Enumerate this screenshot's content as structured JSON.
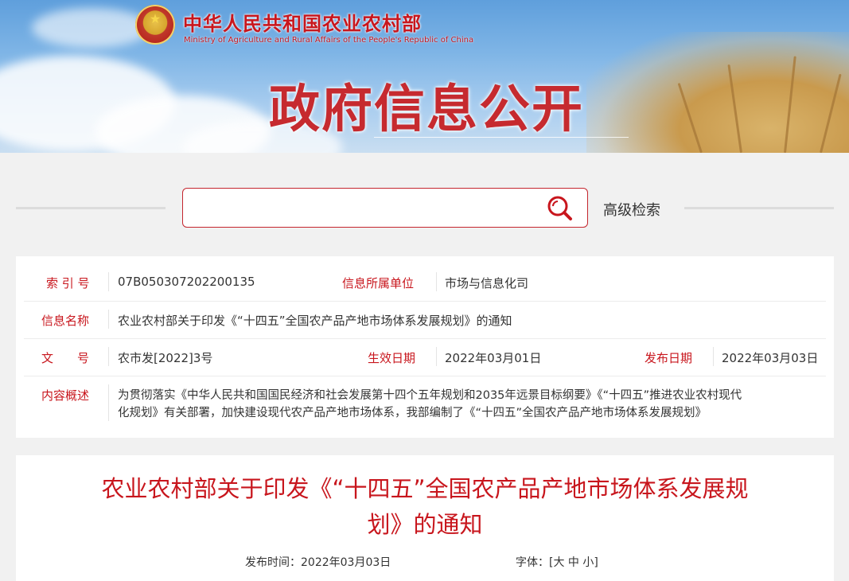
{
  "header": {
    "ministry_cn": "中华人民共和国农业农村部",
    "ministry_en": "Ministry of Agriculture and Rural Affairs of the People's Republic of China",
    "banner_title": "政府信息公开"
  },
  "search": {
    "placeholder": "",
    "advanced_label": "高级检索"
  },
  "info": {
    "index_label": "索 引 号",
    "index_value": "07B050307202200135",
    "unit_label": "信息所属单位",
    "unit_value": "市场与信息化司",
    "name_label": "信息名称",
    "name_value": "农业农村部关于印发《“十四五”全国农产品产地市场体系发展规划》的通知",
    "doc_label": "文　　号",
    "doc_value": "农市发[2022]3号",
    "effective_label": "生效日期",
    "effective_value": "2022年03月01日",
    "publish_label": "发布日期",
    "publish_value": "2022年03月03日",
    "summary_label": "内容概述",
    "summary_line1": "为贯彻落实《中华人民共和国国民经济和社会发展第十四个五年规划和2035年远景目标纲要》《“十四五”推进农业农村现代",
    "summary_line2": "化规划》有关部署，加快建设现代农产品产地市场体系，我部编制了《“十四五”全国农产品产地市场体系发展规划》"
  },
  "article": {
    "title_line1": "农业农村部关于印发《“十四五”全国农产品产地市场体系发展规",
    "title_line2": "划》的通知",
    "publish_time_label": "发布时间：",
    "publish_time_value": "2022年03月03日",
    "font_size_label": "字体：",
    "font_bracket_open": "[",
    "font_large": "大",
    "font_medium": "中",
    "font_small": "小",
    "font_bracket_close": "]"
  },
  "colors": {
    "accent_red": "#c8161d",
    "search_border": "#c4262e"
  }
}
